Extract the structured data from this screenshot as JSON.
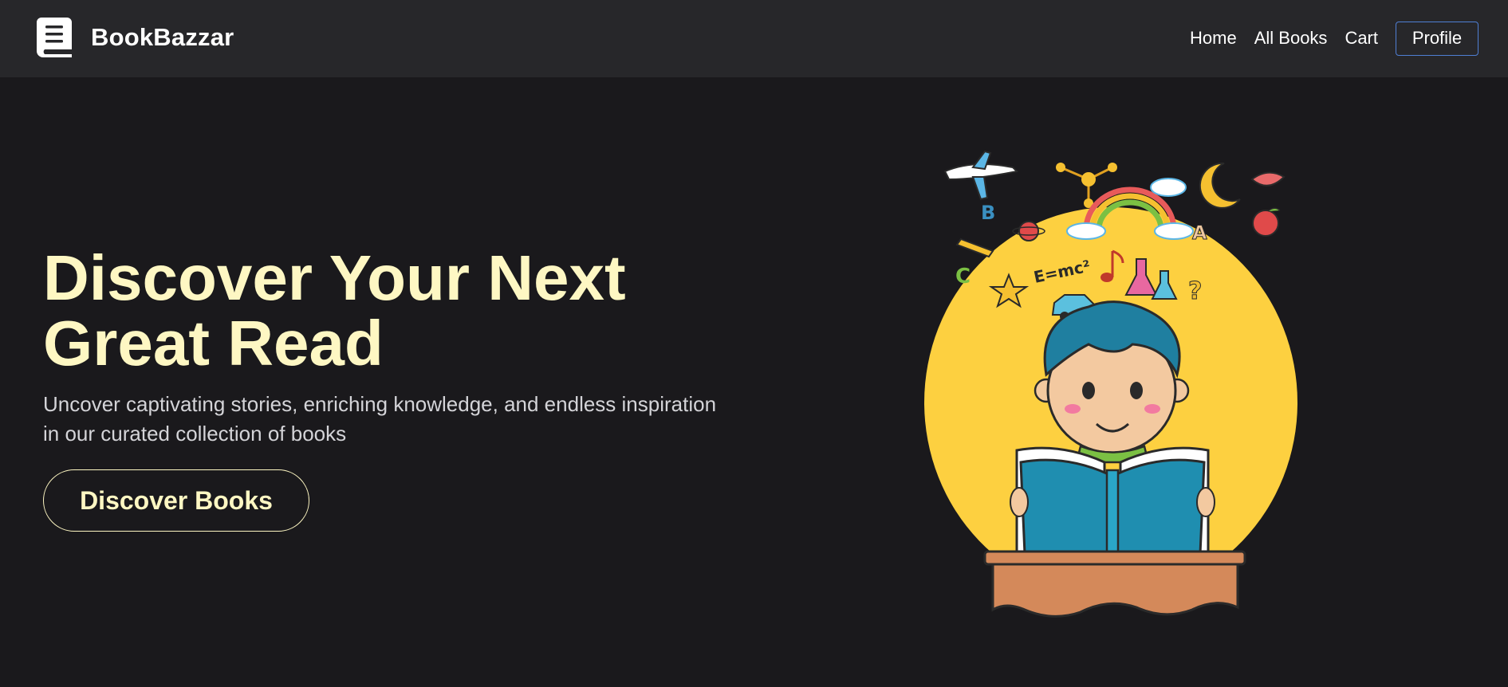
{
  "brand": {
    "name": "BookBazzar",
    "icon": "book-icon"
  },
  "nav": {
    "links": [
      "Home",
      "All Books",
      "Cart"
    ],
    "profile_label": "Profile"
  },
  "hero": {
    "title_line1": "Discover Your Next",
    "title_line2": "Great Read",
    "subtitle_line1": "Uncover captivating stories, enriching knowledge, and endless inspiration",
    "subtitle_line2": "in our curated collection of books",
    "cta_label": "Discover Books",
    "illustration": "boy-reading-book-illustration",
    "illustration_formula": "E=mc²"
  },
  "colors": {
    "background": "#1a191c",
    "navbar": "#27272a",
    "accent_text": "#fef7c3",
    "profile_border": "#4f7fd4",
    "illustration_circle": "#fdd040"
  }
}
